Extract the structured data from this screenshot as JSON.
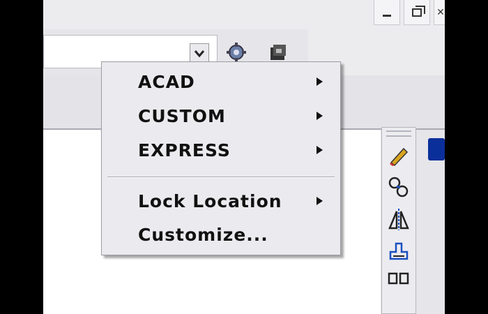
{
  "window_controls": {
    "minimize_icon": "minimize-icon",
    "restore_icon": "restore-icon",
    "close_icon": "close-icon"
  },
  "context_menu": {
    "items": [
      {
        "label": "ACAD",
        "has_submenu": true
      },
      {
        "label": "CUSTOM",
        "has_submenu": true
      },
      {
        "label": "EXPRESS",
        "has_submenu": true
      },
      {
        "label": "Lock Location",
        "has_submenu": true
      },
      {
        "label": "Customize...",
        "has_submenu": false
      }
    ]
  },
  "toolbar": {
    "icons": [
      "dropdown-arrow-icon",
      "settings-gear-icon",
      "layer-tool-icon"
    ]
  },
  "side_toolbar": {
    "icons": [
      "pencil-icon",
      "copy-object-icon",
      "mirror-icon",
      "offset-icon",
      "array-icon"
    ]
  },
  "colors": {
    "menu_bg": "#ebebef",
    "blue_tab": "#0b2f9a"
  }
}
